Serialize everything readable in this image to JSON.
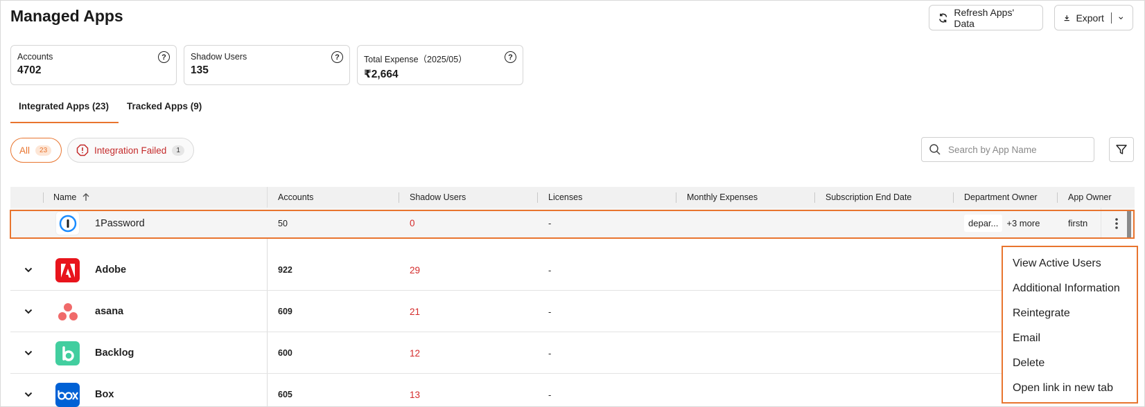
{
  "page": {
    "title": "Managed Apps"
  },
  "toolbar": {
    "refresh_label": "Refresh Apps' Data",
    "export_label": "Export"
  },
  "cards": [
    {
      "label": "Accounts",
      "value": "4702"
    },
    {
      "label": "Shadow Users",
      "value": "135"
    },
    {
      "label": "Total Expense（2025/05）",
      "value": "₹2,664"
    }
  ],
  "tabs": [
    {
      "label": "Integrated Apps (23)",
      "active": true
    },
    {
      "label": "Tracked Apps (9)",
      "active": false
    }
  ],
  "filters": {
    "all_label": "All",
    "all_count": "23",
    "failed_label": "Integration Failed",
    "failed_count": "1"
  },
  "search": {
    "placeholder": "Search by App Name",
    "value": ""
  },
  "table": {
    "columns": [
      "Name",
      "Accounts",
      "Shadow Users",
      "Licenses",
      "Monthly Expenses",
      "Subscription End Date",
      "Department Owner",
      "App Owner"
    ],
    "sort": {
      "column": "Name",
      "direction": "asc"
    },
    "rows": [
      {
        "name": "1Password",
        "accounts": "50",
        "shadow_users": "0",
        "licenses": "-",
        "department_owner": "depar...",
        "department_more": "+3 more",
        "app_owner": "firstn",
        "logo": "1password-logo",
        "logo_color": "#1a8cff"
      },
      {
        "name": "Adobe",
        "accounts": "922",
        "shadow_users": "29",
        "licenses": "-",
        "logo": "adobe-logo",
        "logo_color": "#e8141c"
      },
      {
        "name": "asana",
        "accounts": "609",
        "shadow_users": "21",
        "licenses": "-",
        "logo": "asana-logo",
        "logo_color": "#f06a6a"
      },
      {
        "name": "Backlog",
        "accounts": "600",
        "shadow_users": "12",
        "licenses": "-",
        "logo": "backlog-logo",
        "logo_color": "#42ce9f"
      },
      {
        "name": "Box",
        "accounts": "605",
        "shadow_users": "13",
        "licenses": "-",
        "logo": "box-logo",
        "logo_color": "#0061d5"
      }
    ]
  },
  "context_menu": {
    "items": [
      "View Active Users",
      "Additional Information",
      "Reintegrate",
      "Email",
      "Delete",
      "Open link in new tab"
    ]
  },
  "colors": {
    "accent": "#e8742e",
    "danger": "#d42a2a"
  }
}
